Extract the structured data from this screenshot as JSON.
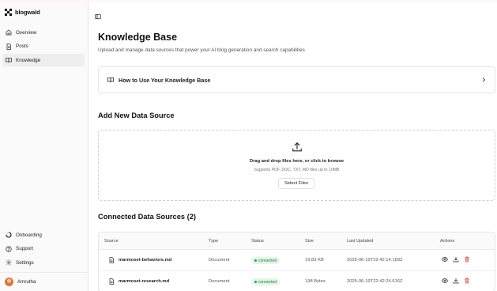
{
  "app": {
    "name": "blogwald"
  },
  "sidebar": {
    "items": [
      {
        "label": "Overview",
        "icon": "home-icon"
      },
      {
        "label": "Posts",
        "icon": "file-icon"
      },
      {
        "label": "Knowledge",
        "icon": "book-icon",
        "active": true
      }
    ],
    "bottom_items": [
      {
        "label": "Onboarding",
        "icon": "progress-icon"
      },
      {
        "label": "Support",
        "icon": "help-icon"
      },
      {
        "label": "Settings",
        "icon": "gear-icon"
      }
    ],
    "user": {
      "name": "Amrutha"
    }
  },
  "main": {
    "title": "Knowledge Base",
    "subtitle": "Upload and manage data sources that power your AI blog generation and search capabilities",
    "howto": {
      "label": "How to Use Your Knowledge Base"
    },
    "add_section": {
      "title": "Add New Data Source",
      "drop_text": "Drag and drop files here, or click to browse",
      "supports_text": "Supports PDF, DOC, TXT, MD files up to 10MB",
      "button_label": "Select Files"
    },
    "connected": {
      "title": "Connected Data Sources (2)",
      "columns": [
        "Source",
        "Type",
        "Status",
        "Size",
        "Last Updated",
        "Actions"
      ],
      "rows": [
        {
          "source": "marmoset-behaviors.md",
          "type": "Document",
          "status": "connected",
          "size": "19.83 KB",
          "updated": "2025-06-19T22:42:14.183Z"
        },
        {
          "source": "marmoset-research.md",
          "type": "Document",
          "status": "connected",
          "size": "198 Bytes",
          "updated": "2025-06-19T22:42:24.616Z"
        }
      ]
    }
  },
  "colors": {
    "connected_bg": "#e3f6e8",
    "connected_text": "#1d7a3b",
    "delete": "#d63a3a"
  }
}
